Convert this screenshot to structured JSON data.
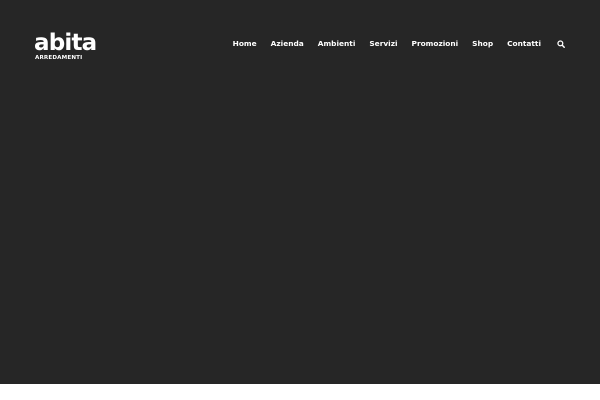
{
  "brand": {
    "name": "abita",
    "tagline": "ARREDAMENTI"
  },
  "nav": {
    "items": [
      {
        "label": "Home"
      },
      {
        "label": "Azienda"
      },
      {
        "label": "Ambienti"
      },
      {
        "label": "Servizi"
      },
      {
        "label": "Promozioni"
      },
      {
        "label": "Shop"
      },
      {
        "label": "Contatti"
      }
    ],
    "search_icon": "search-icon"
  },
  "colors": {
    "hero_background": "#262626",
    "text": "#ffffff",
    "page_background": "#ffffff"
  }
}
